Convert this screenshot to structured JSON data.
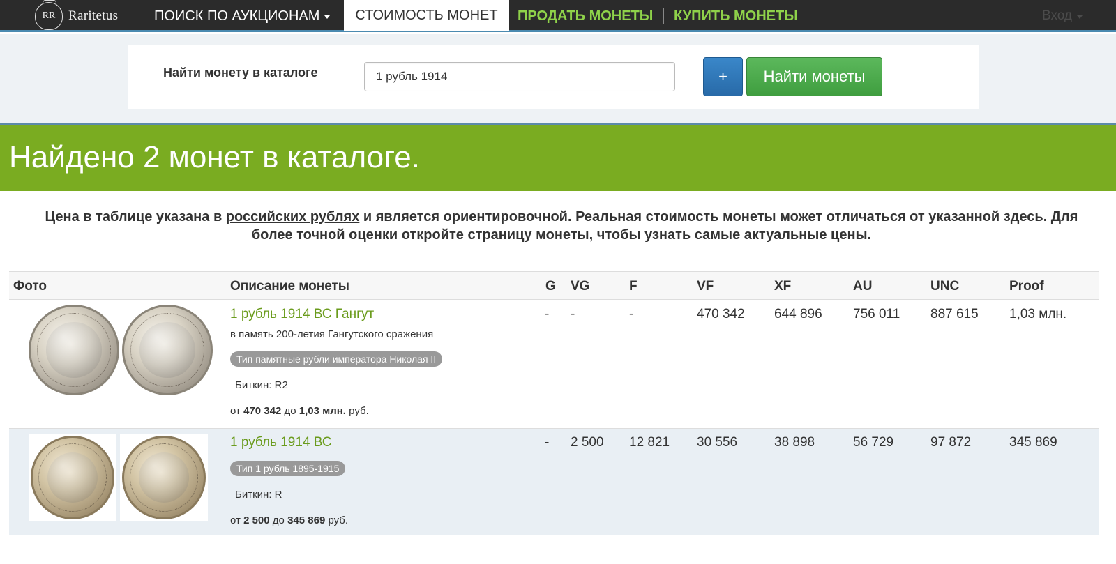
{
  "nav": {
    "brand": "Raritetus",
    "brand_logo_text": "RR",
    "auctions": "ПОИСК ПО АУКЦИОНАМ",
    "coin_value": "СТОИМОСТЬ МОНЕТ",
    "sell": "ПРОДАТЬ МОНЕТЫ",
    "buy": "КУПИТЬ МОНЕТЫ",
    "login": "Вход"
  },
  "search": {
    "label": "Найти монету в каталоге",
    "value": "1 рубль 1914",
    "plus_label": "+",
    "find_label": "Найти монеты"
  },
  "banner": {
    "title": "Найдено 2 монет в каталоге."
  },
  "notice": {
    "part1": "Цена в таблице указана в ",
    "link": "российских рублях",
    "part2": " и является ориентировочной. Реальная стоимость монеты может отличаться от указанной здесь. Для более точной оценки откройте страницу монеты, чтобы узнать самые актуальные цены."
  },
  "table": {
    "headers": [
      "Фото",
      "Описание монеты",
      "G",
      "VG",
      "F",
      "VF",
      "XF",
      "AU",
      "UNC",
      "Proof"
    ],
    "rows": [
      {
        "title": "1 рубль 1914 ВС Гангут",
        "subtitle": "в память 200-летия Гангутского сражения",
        "type_badge": "Тип памятные рубли императора Николая II",
        "bitkin": "Биткин: R2",
        "range_from_label": "от",
        "range_from": "470 342",
        "range_to_label": "до",
        "range_to": "1,03 млн.",
        "range_currency": "руб.",
        "prices": [
          "-",
          "-",
          "-",
          "470 342",
          "644 896",
          "756 011",
          "887 615",
          "1,03 млн."
        ]
      },
      {
        "title": "1 рубль 1914 ВС",
        "type_badge": "Тип 1 рубль 1895-1915",
        "bitkin": "Биткин: R",
        "range_from_label": "от",
        "range_from": "2 500",
        "range_to_label": "до",
        "range_to": "345 869",
        "range_currency": "руб.",
        "prices": [
          "-",
          "2 500",
          "12 821",
          "30 556",
          "38 898",
          "56 729",
          "97 872",
          "345 869"
        ]
      }
    ]
  }
}
